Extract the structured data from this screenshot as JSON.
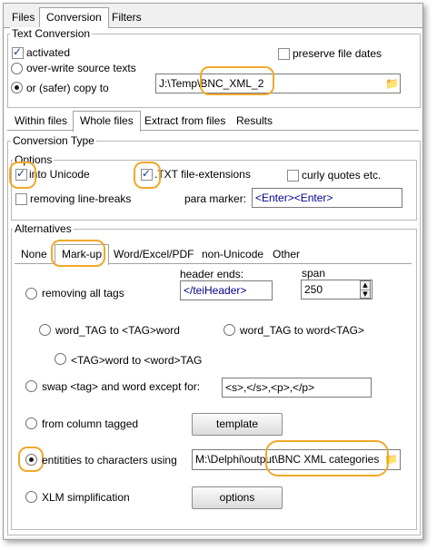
{
  "main_tabs": [
    "Files",
    "Conversion",
    "Filters"
  ],
  "text_conversion": {
    "title": "Text Conversion",
    "activated": "activated",
    "preserve_dates": "preserve file dates",
    "overwrite": "over-write source texts",
    "copy_to": "or (safer) copy to",
    "copy_path": "J:\\Temp\\BNC_XML_2"
  },
  "sub_tabs": [
    "Within files",
    "Whole files",
    "Extract from files",
    "Results"
  ],
  "conversion_type": {
    "title": "Conversion Type",
    "options": {
      "title": "Options",
      "unicode": "into Unicode",
      "txt_ext": ".TXT file-extensions",
      "curly": "curly quotes etc.",
      "linebreaks": "removing line-breaks",
      "para_marker_label": "para marker:",
      "para_marker_value": "<Enter><Enter>"
    }
  },
  "alternatives": {
    "title": "Alternatives",
    "tabs": [
      "None",
      "Mark-up",
      "Word/Excel/PDF",
      "non-Unicode",
      "Other"
    ],
    "header_ends_label": "header ends:",
    "header_ends_value": "</teiHeader>",
    "span_label": "span",
    "span_value": "250",
    "removing_tags": "removing all tags",
    "word_tag_to_tag_word": "word_TAG to <TAG>word",
    "word_tag_to_word_tag": "word_TAG to word<TAG>",
    "tag_word_to_word_tag": "<TAG>word to <word>TAG",
    "swap": "swap <tag> and word except for:",
    "swap_value": "<s>,</s>,<p>,</p>",
    "column_tagged": "from column tagged",
    "template_btn": "template",
    "entities": "entitities to characters using",
    "entities_path": "M:\\Delphi\\output\\BNC XML categories",
    "xlm": "XLM simplification",
    "options_btn": "options"
  },
  "colors": {
    "highlight": "#f0a92b",
    "field_text": "#00008b"
  }
}
